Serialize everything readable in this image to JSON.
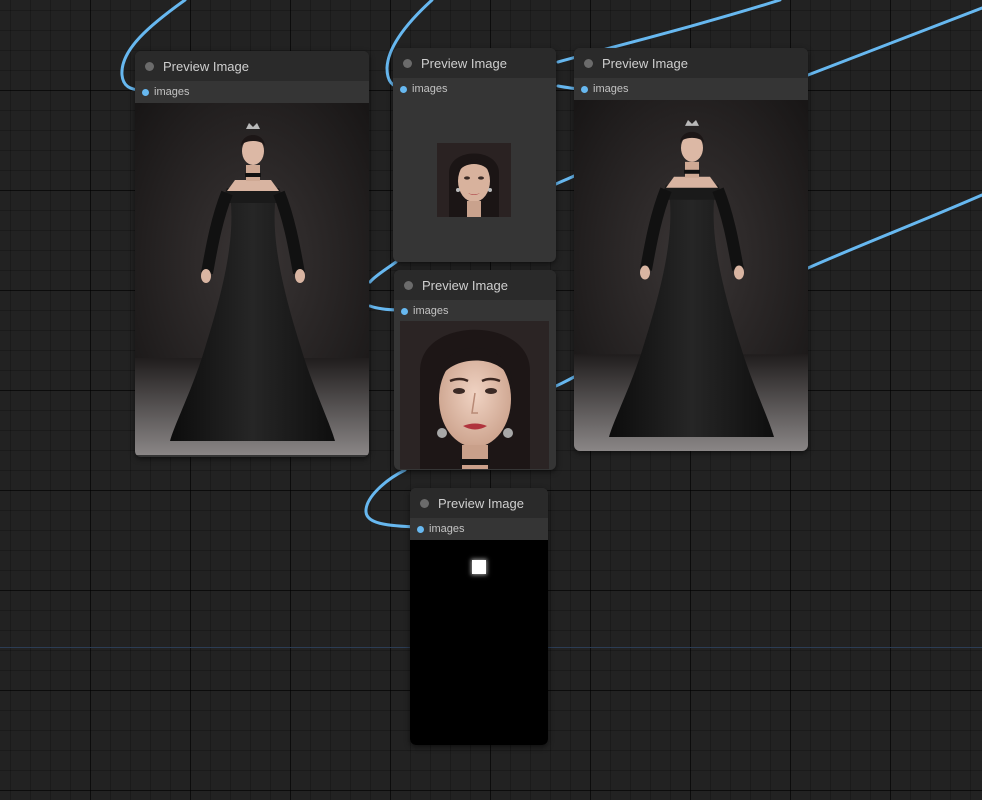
{
  "nodes": [
    {
      "title": "Preview Image",
      "input_label": "images",
      "preview": "full-body portrait"
    },
    {
      "title": "Preview Image",
      "input_label": "images",
      "preview": "small face crop"
    },
    {
      "title": "Preview Image",
      "input_label": "images",
      "preview": "full-body portrait"
    },
    {
      "title": "Preview Image",
      "input_label": "images",
      "preview": "close-up face"
    },
    {
      "title": "Preview Image",
      "input_label": "images",
      "preview": "black mask with white square"
    }
  ],
  "colors": {
    "canvas": "#222222",
    "node_body": "#353535",
    "node_title": "#2a2a2a",
    "link": "#67b8f0",
    "slot": "#67b8f0"
  }
}
